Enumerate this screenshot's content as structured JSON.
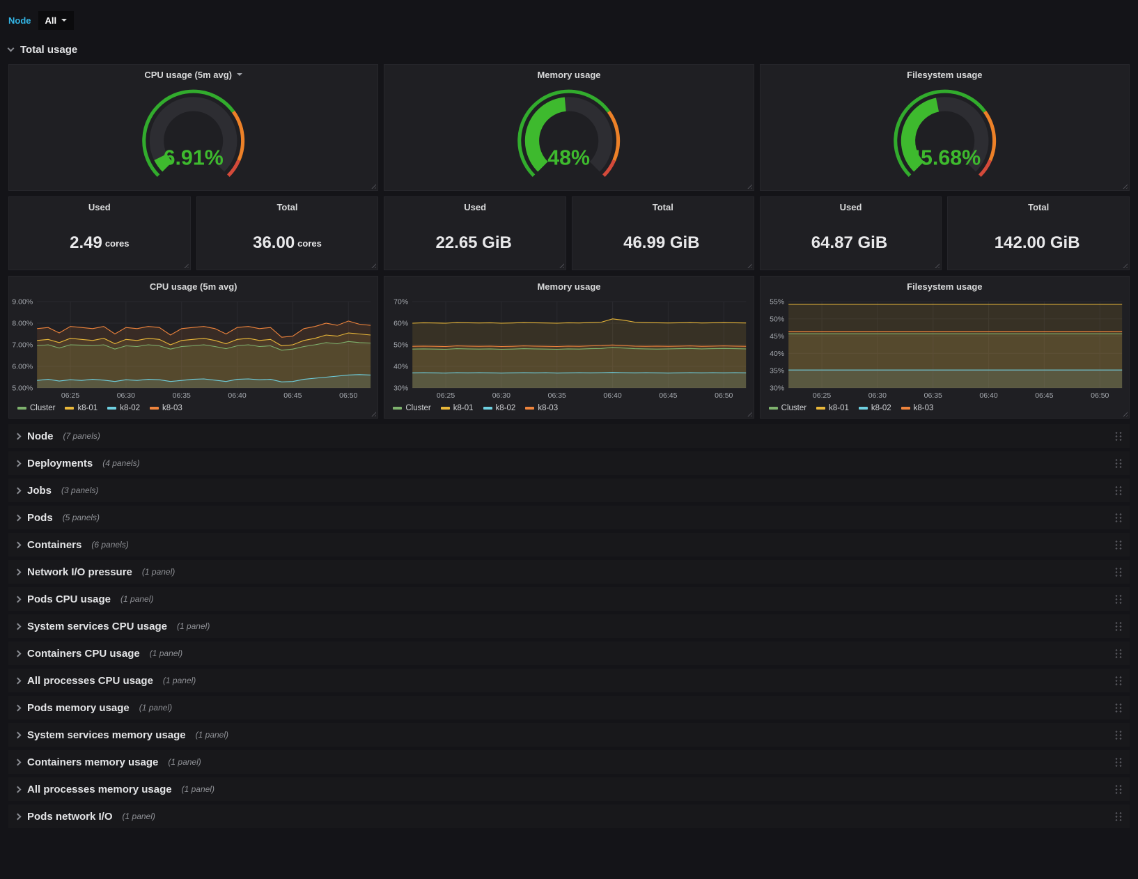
{
  "templating": {
    "label": "Node",
    "value": "All"
  },
  "rows": {
    "total": {
      "title": "Total usage"
    },
    "collapsed": [
      {
        "title": "Node",
        "count": "(7 panels)"
      },
      {
        "title": "Deployments",
        "count": "(4 panels)"
      },
      {
        "title": "Jobs",
        "count": "(3 panels)"
      },
      {
        "title": "Pods",
        "count": "(5 panels)"
      },
      {
        "title": "Containers",
        "count": "(6 panels)"
      },
      {
        "title": "Network I/O pressure",
        "count": "(1 panel)"
      },
      {
        "title": "Pods CPU usage",
        "count": "(1 panel)"
      },
      {
        "title": "System services CPU usage",
        "count": "(1 panel)"
      },
      {
        "title": "Containers CPU usage",
        "count": "(1 panel)"
      },
      {
        "title": "All processes CPU usage",
        "count": "(1 panel)"
      },
      {
        "title": "Pods memory usage",
        "count": "(1 panel)"
      },
      {
        "title": "System services memory usage",
        "count": "(1 panel)"
      },
      {
        "title": "Containers memory usage",
        "count": "(1 panel)"
      },
      {
        "title": "All processes memory usage",
        "count": "(1 panel)"
      },
      {
        "title": "Pods network I/O",
        "count": "(1 panel)"
      }
    ]
  },
  "gauges": [
    {
      "title": "CPU usage (5m avg)",
      "value": 6.91,
      "display": "6.91%"
    },
    {
      "title": "Memory usage",
      "value": 48,
      "display": "48%"
    },
    {
      "title": "Filesystem usage",
      "value": 45.68,
      "display": "45.68%"
    }
  ],
  "gauge_style": {
    "thresholds": [
      {
        "to": 0.7,
        "color": "#32ac2d"
      },
      {
        "to": 0.92,
        "color": "#ed8128"
      },
      {
        "to": 1.0,
        "color": "#d44a3a"
      }
    ],
    "value_color": "#3eba2e",
    "track_color": "#2d2d32"
  },
  "stats": [
    {
      "title": "Used",
      "value": "2.49",
      "unit": "cores"
    },
    {
      "title": "Total",
      "value": "36.00",
      "unit": "cores"
    },
    {
      "title": "Used",
      "value": "22.65 GiB",
      "unit": ""
    },
    {
      "title": "Total",
      "value": "46.99 GiB",
      "unit": ""
    },
    {
      "title": "Used",
      "value": "64.87 GiB",
      "unit": ""
    },
    {
      "title": "Total",
      "value": "142.00 GiB",
      "unit": ""
    }
  ],
  "icons": {
    "chevron-down": "css-chevron",
    "chevron-right": "css-chevron",
    "caret-down": "css-triangle",
    "drag-handle": "dot-grid",
    "panel-resize": "diagonal-lines"
  },
  "colors": {
    "accent": "#33b5e5",
    "page_bg": "#141418",
    "panel_bg": "#1f1f23",
    "series_green": "#7EB26D",
    "series_yellow": "#EAB839",
    "series_cyan": "#6ED0E0",
    "series_orange": "#EF843C"
  },
  "chart_data": [
    {
      "type": "line",
      "title": "CPU usage (5m avg)",
      "ylim": [
        5,
        9
      ],
      "grid": true,
      "legend_position": "bottom",
      "y_ticks": [
        {
          "v": 9,
          "label": "9.00%"
        },
        {
          "v": 8,
          "label": "8.00%"
        },
        {
          "v": 7,
          "label": "7.00%"
        },
        {
          "v": 6,
          "label": "6.00%"
        },
        {
          "v": 5,
          "label": "5.00%"
        }
      ],
      "x_ticks": [
        {
          "label": "06:25",
          "f": 0.1
        },
        {
          "label": "06:30",
          "f": 0.2667
        },
        {
          "label": "06:35",
          "f": 0.4333
        },
        {
          "label": "06:40",
          "f": 0.6
        },
        {
          "label": "06:45",
          "f": 0.7667
        },
        {
          "label": "06:50",
          "f": 0.9333
        }
      ],
      "series": [
        {
          "name": "Cluster",
          "color": "#7EB26D",
          "values": [
            6.95,
            7.0,
            6.85,
            7.0,
            6.98,
            6.95,
            7.0,
            6.8,
            6.95,
            6.92,
            7.0,
            6.95,
            6.8,
            6.92,
            6.95,
            7.0,
            6.92,
            6.82,
            6.95,
            7.0,
            6.92,
            6.95,
            6.75,
            6.8,
            6.92,
            7.0,
            7.1,
            7.05,
            7.15,
            7.1,
            7.08
          ]
        },
        {
          "name": "k8-01",
          "color": "#EAB839",
          "values": [
            7.2,
            7.25,
            7.1,
            7.3,
            7.25,
            7.2,
            7.3,
            7.05,
            7.25,
            7.2,
            7.3,
            7.25,
            7.0,
            7.2,
            7.25,
            7.3,
            7.2,
            7.05,
            7.25,
            7.3,
            7.2,
            7.25,
            6.95,
            7.0,
            7.2,
            7.3,
            7.45,
            7.4,
            7.55,
            7.5,
            7.45
          ]
        },
        {
          "name": "k8-02",
          "color": "#6ED0E0",
          "values": [
            5.35,
            5.4,
            5.32,
            5.38,
            5.35,
            5.4,
            5.36,
            5.3,
            5.38,
            5.35,
            5.4,
            5.38,
            5.3,
            5.35,
            5.4,
            5.42,
            5.36,
            5.3,
            5.4,
            5.42,
            5.38,
            5.4,
            5.28,
            5.3,
            5.4,
            5.45,
            5.5,
            5.55,
            5.6,
            5.62,
            5.6
          ]
        },
        {
          "name": "k8-03",
          "color": "#EF843C",
          "values": [
            7.75,
            7.8,
            7.55,
            7.85,
            7.8,
            7.75,
            7.85,
            7.5,
            7.8,
            7.75,
            7.85,
            7.8,
            7.45,
            7.75,
            7.8,
            7.85,
            7.75,
            7.5,
            7.8,
            7.85,
            7.75,
            7.8,
            7.35,
            7.4,
            7.75,
            7.85,
            8.0,
            7.9,
            8.1,
            7.95,
            7.9
          ]
        }
      ]
    },
    {
      "type": "line",
      "title": "Memory usage",
      "ylim": [
        30,
        70
      ],
      "grid": true,
      "legend_position": "bottom",
      "y_ticks": [
        {
          "v": 70,
          "label": "70%"
        },
        {
          "v": 60,
          "label": "60%"
        },
        {
          "v": 50,
          "label": "50%"
        },
        {
          "v": 40,
          "label": "40%"
        },
        {
          "v": 30,
          "label": "30%"
        }
      ],
      "x_ticks": [
        {
          "label": "06:25",
          "f": 0.1
        },
        {
          "label": "06:30",
          "f": 0.2667
        },
        {
          "label": "06:35",
          "f": 0.4333
        },
        {
          "label": "06:40",
          "f": 0.6
        },
        {
          "label": "06:45",
          "f": 0.7667
        },
        {
          "label": "06:50",
          "f": 0.9333
        }
      ],
      "series": [
        {
          "name": "Cluster",
          "color": "#7EB26D",
          "values": [
            48,
            48.1,
            48,
            47.9,
            48.2,
            48.1,
            48,
            48.1,
            47.9,
            48,
            48.2,
            48.1,
            48,
            47.9,
            48.1,
            48,
            48.2,
            48.3,
            48.8,
            48.5,
            48.2,
            48.1,
            48,
            48.1,
            48.2,
            48.3,
            48.1,
            48.2,
            48.3,
            48.2,
            48.1
          ]
        },
        {
          "name": "k8-01",
          "color": "#EAB839",
          "values": [
            60,
            60.2,
            60.1,
            60,
            60.3,
            60.2,
            60.1,
            60.2,
            60,
            60.1,
            60.3,
            60.2,
            60.1,
            60,
            60.2,
            60.1,
            60.3,
            60.5,
            62,
            61.4,
            60.5,
            60.3,
            60.2,
            60.1,
            60.2,
            60.3,
            60.1,
            60.2,
            60.3,
            60.2,
            60.1
          ]
        },
        {
          "name": "k8-02",
          "color": "#6ED0E0",
          "values": [
            37,
            37.1,
            37,
            36.9,
            37.1,
            37,
            37.1,
            37,
            36.9,
            37,
            37.1,
            37,
            37.1,
            36.9,
            37,
            37.1,
            37,
            37.1,
            37.2,
            37.1,
            37,
            37.1,
            37,
            36.9,
            37,
            37.1,
            37,
            37.1,
            37,
            37.1,
            37
          ]
        },
        {
          "name": "k8-03",
          "color": "#EF843C",
          "values": [
            49.3,
            49.4,
            49.3,
            49.2,
            49.5,
            49.4,
            49.3,
            49.4,
            49.2,
            49.3,
            49.5,
            49.4,
            49.3,
            49.2,
            49.4,
            49.3,
            49.5,
            49.6,
            49.9,
            49.6,
            49.4,
            49.3,
            49.4,
            49.3,
            49.4,
            49.5,
            49.3,
            49.4,
            49.5,
            49.4,
            49.3
          ]
        }
      ]
    },
    {
      "type": "line",
      "title": "Filesystem usage",
      "ylim": [
        30,
        55
      ],
      "grid": true,
      "legend_position": "bottom",
      "y_ticks": [
        {
          "v": 55,
          "label": "55%"
        },
        {
          "v": 50,
          "label": "50%"
        },
        {
          "v": 45,
          "label": "45%"
        },
        {
          "v": 40,
          "label": "40%"
        },
        {
          "v": 35,
          "label": "35%"
        },
        {
          "v": 30,
          "label": "30%"
        }
      ],
      "x_ticks": [
        {
          "label": "06:25",
          "f": 0.1
        },
        {
          "label": "06:30",
          "f": 0.2667
        },
        {
          "label": "06:35",
          "f": 0.4333
        },
        {
          "label": "06:40",
          "f": 0.6
        },
        {
          "label": "06:45",
          "f": 0.7667
        },
        {
          "label": "06:50",
          "f": 0.9333
        }
      ],
      "series": [
        {
          "name": "Cluster",
          "color": "#7EB26D",
          "values": [
            45.68,
            45.68
          ]
        },
        {
          "name": "k8-01",
          "color": "#EAB839",
          "values": [
            54.2,
            54.2
          ]
        },
        {
          "name": "k8-02",
          "color": "#6ED0E0",
          "values": [
            35.2,
            35.2
          ]
        },
        {
          "name": "k8-03",
          "color": "#EF843C",
          "values": [
            46.4,
            46.4
          ]
        }
      ]
    }
  ]
}
